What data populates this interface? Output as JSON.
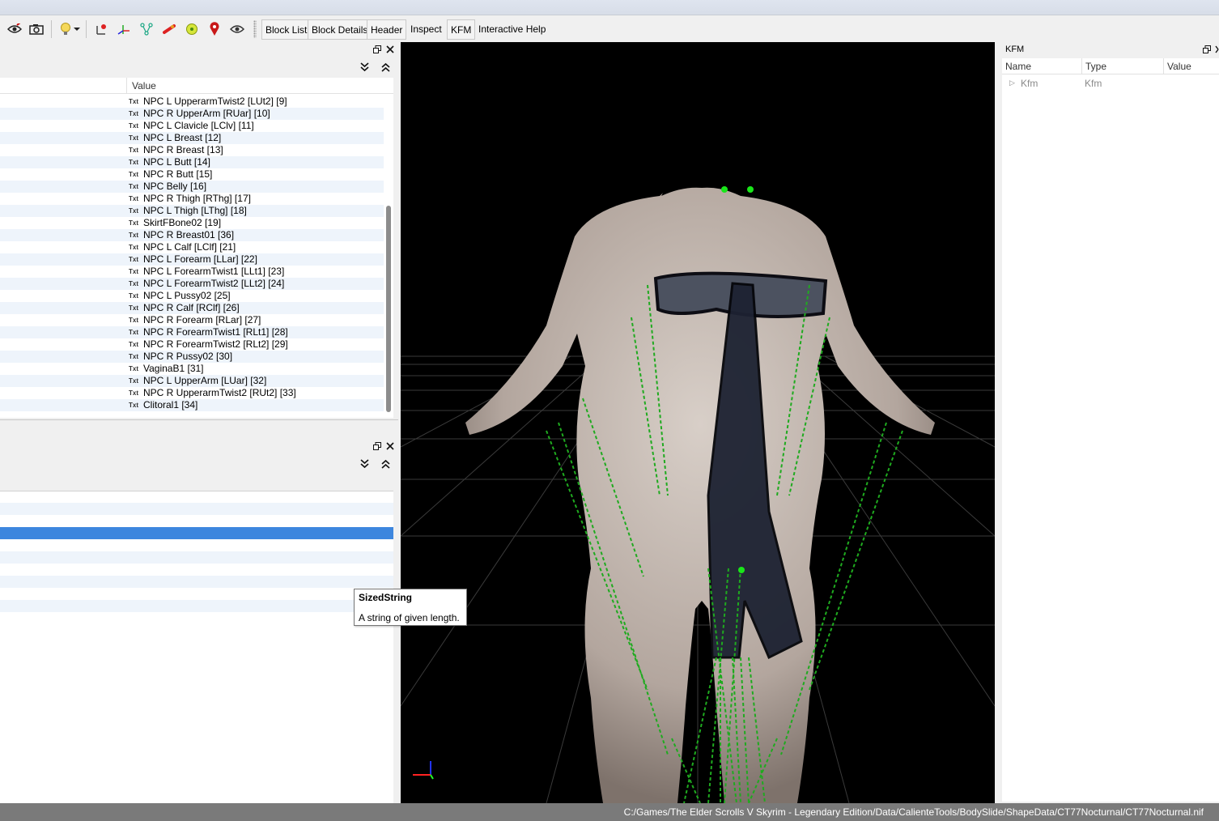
{
  "toolbar": {
    "icons": [
      "eye-view-icon",
      "camera-icon",
      "light-bulb-icon",
      "dropdown-arrow-icon",
      "axes-icon",
      "node-axes-icon",
      "skeleton-icon",
      "bone-icon",
      "circle-icon",
      "map-pin-icon",
      "eye-icon"
    ],
    "buttons": [
      "Block List",
      "Block Details",
      "Header",
      "Inspect",
      "KFM",
      "Interactive Help"
    ]
  },
  "block_list": {
    "column_value": "Value",
    "type_tag": "Txt",
    "rows": [
      "NPC L UpperarmTwist2 [LUt2] [9]",
      "NPC R UpperArm [RUar] [10]",
      "NPC L Clavicle [LClv] [11]",
      "NPC L Breast [12]",
      "NPC R Breast [13]",
      "NPC L Butt [14]",
      "NPC R Butt [15]",
      "NPC Belly [16]",
      "NPC R Thigh [RThg] [17]",
      "NPC L Thigh [LThg] [18]",
      "SkirtFBone02 [19]",
      "NPC R Breast01 [36]",
      "NPC L Calf [LClf] [21]",
      "NPC L Forearm [LLar] [22]",
      "NPC L ForearmTwist1 [LLt1] [23]",
      "NPC L ForearmTwist2 [LLt2] [24]",
      "NPC L Pussy02 [25]",
      "NPC R Calf [RClf] [26]",
      "NPC R Forearm [RLar] [27]",
      "NPC R ForearmTwist1 [RLt1] [28]",
      "NPC R ForearmTwist2 [RLt2] [29]",
      "NPC R Pussy02 [30]",
      "VaginaB1 [31]",
      "NPC L UpperArm [LUar] [32]",
      "NPC R UpperarmTwist2 [RUt2] [33]",
      "Clitoral1 [34]"
    ]
  },
  "tooltip": {
    "title": "SizedString",
    "description": "A string of given length."
  },
  "kfm": {
    "title": "KFM",
    "columns": [
      "Name",
      "Type",
      "Value"
    ],
    "rows": [
      {
        "name": "Kfm",
        "type": "Kfm"
      }
    ]
  },
  "statusbar": {
    "path": "C:/Games/The Elder Scrolls V Skyrim - Legendary Edition/Data/CalienteTools/BodySlide/ShapeData/CT77Nocturnal/CT77Nocturnal.nif"
  },
  "colors": {
    "selection": "#3d86de",
    "viewport_bg": "#000000",
    "bone_lines": "#1faa1f",
    "status_bar": "#7a7a7a"
  }
}
